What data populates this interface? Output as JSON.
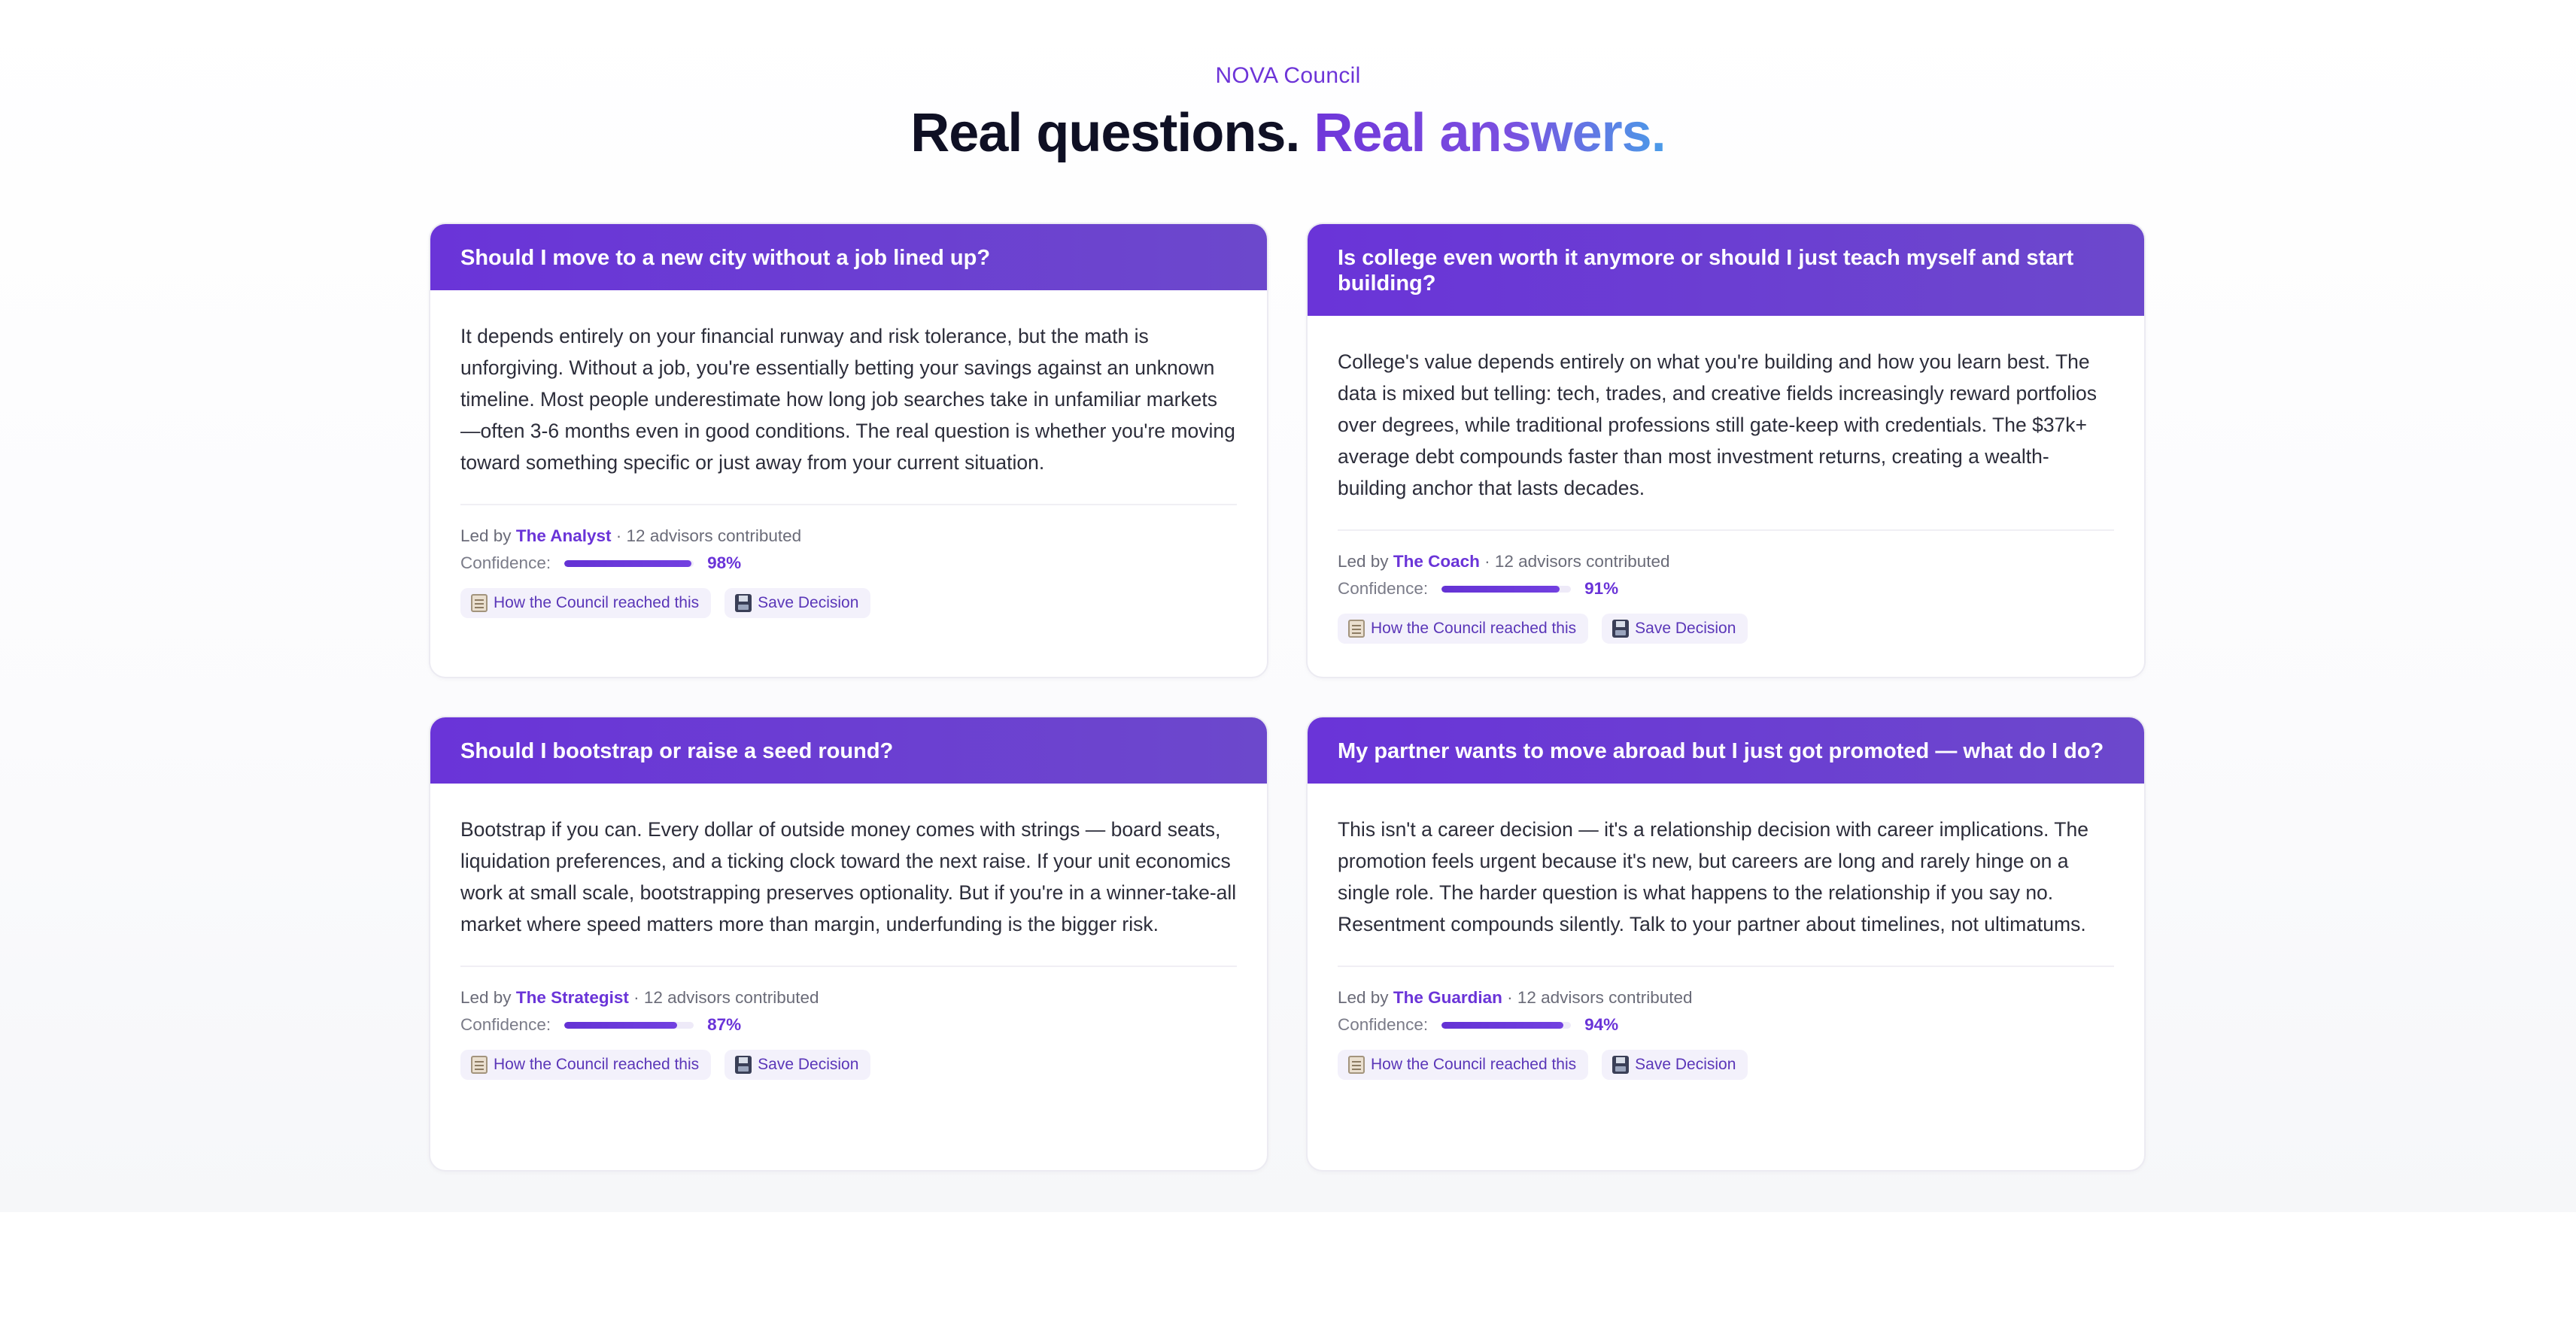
{
  "brand": "NOVA Council",
  "headline": {
    "part1": "Real questions.",
    "part2": "Real answers."
  },
  "led_by_prefix": "Led by",
  "confidence_label": "Confidence:",
  "cards": [
    {
      "question": "Should I move to a new city without a job lined up?",
      "answer": "It depends entirely on your financial runway and risk tolerance, but the math is unforgiving. Without a job, you're essentially betting your savings against an unknown timeline. Most people underestimate how long job searches take in unfamiliar markets—often 3-6 months even in good conditions. The real question is whether you're moving toward something specific or just away from your current situation.",
      "lead": "The Analyst",
      "contributors": "· 12 advisors contributed",
      "confidence": 98,
      "confidence_text": "98%",
      "how_label": "How the Council reached this",
      "save_label": "Save Decision"
    },
    {
      "question": "Is college even worth it anymore or should I just teach myself and start building?",
      "answer": "College's value depends entirely on what you're building and how you learn best. The data is mixed but telling: tech, trades, and creative fields increasingly reward portfolios over degrees, while traditional professions still gate-keep with credentials. The $37k+ average debt compounds faster than most investment returns, creating a wealth-building anchor that lasts decades.",
      "lead": "The Coach",
      "contributors": "· 12 advisors contributed",
      "confidence": 91,
      "confidence_text": "91%",
      "how_label": "How the Council reached this",
      "save_label": "Save Decision"
    },
    {
      "question": "Should I bootstrap or raise a seed round?",
      "answer": "Bootstrap if you can. Every dollar of outside money comes with strings — board seats, liquidation preferences, and a ticking clock toward the next raise. If your unit economics work at small scale, bootstrapping preserves optionality. But if you're in a winner-take-all market where speed matters more than margin, underfunding is the bigger risk.",
      "lead": "The Strategist",
      "contributors": "· 12 advisors contributed",
      "confidence": 87,
      "confidence_text": "87%",
      "how_label": "How the Council reached this",
      "save_label": "Save Decision"
    },
    {
      "question": "My partner wants to move abroad but I just got promoted — what do I do?",
      "answer": "This isn't a career decision — it's a relationship decision with career implications. The promotion feels urgent because it's new, but careers are long and rarely hinge on a single role. The harder question is what happens to the relationship if you say no. Resentment compounds silently. Talk to your partner about timelines, not ultimatums.",
      "lead": "The Guardian",
      "contributors": "· 12 advisors contributed",
      "confidence": 94,
      "confidence_text": "94%",
      "how_label": "How the Council reached this",
      "save_label": "Save Decision"
    }
  ],
  "icons": {
    "how": "ledger-icon",
    "save": "floppy-disk-icon"
  },
  "colors": {
    "accent": "#6a34d8",
    "header_gradient_start": "#6a34d8",
    "header_gradient_end": "#6c48cc",
    "headline_gradient_end": "#4a9ce8"
  }
}
